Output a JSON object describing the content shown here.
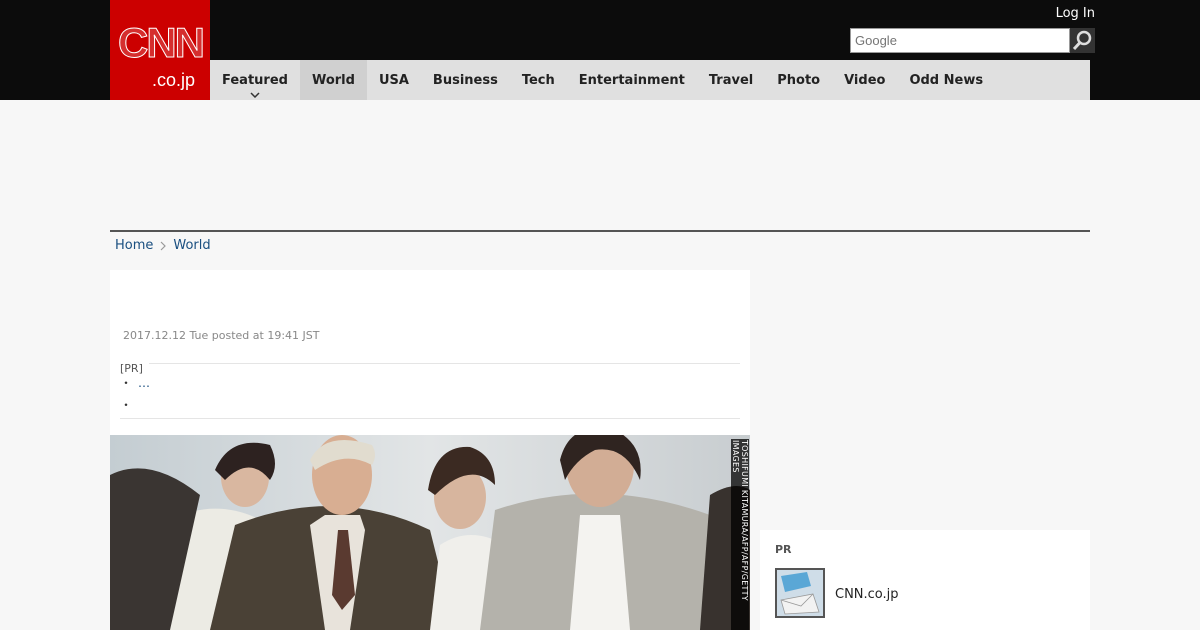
{
  "header": {
    "logo_main": "CNN",
    "logo_sub": ".co.jp",
    "login_label": "Log In",
    "search_placeholder": "Google",
    "brand_color": "#cc0000"
  },
  "nav": {
    "items": [
      {
        "label": "Featured"
      },
      {
        "label": "World"
      },
      {
        "label": "USA"
      },
      {
        "label": "Business"
      },
      {
        "label": "Tech"
      },
      {
        "label": "Entertainment"
      },
      {
        "label": "Travel"
      },
      {
        "label": "Photo"
      },
      {
        "label": "Video"
      },
      {
        "label": "Odd News"
      }
    ],
    "active": "World"
  },
  "breadcrumb": {
    "home": "Home",
    "current": "World"
  },
  "article": {
    "timestamp": "2017.12.12 Tue posted at 19:41 JST",
    "pr_label": "[PR]",
    "pr_bullet_1": "・",
    "pr_link_1": "…",
    "pr_bullet_2": "・",
    "photo_credit": "TOSHIFUMI KITAMURA/AFP/AFP/GETTY IMAGES"
  },
  "sidebar": {
    "pr_title": "PR",
    "pr_item": "CNN.co.jp"
  }
}
